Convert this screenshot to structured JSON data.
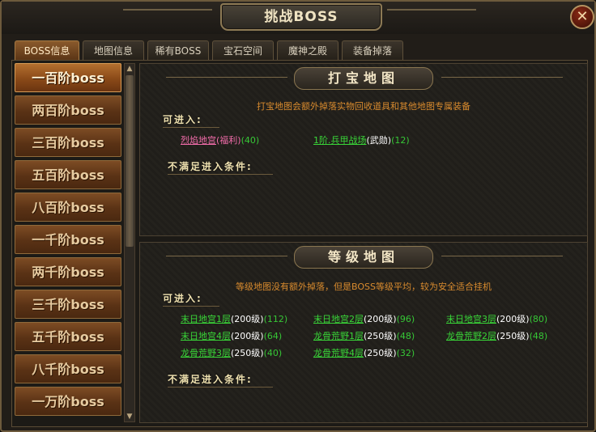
{
  "window": {
    "title": "挑战BOSS",
    "close_label": "✕"
  },
  "tabs": [
    {
      "label": "BOSS信息",
      "active": true
    },
    {
      "label": "地图信息",
      "active": false
    },
    {
      "label": "稀有BOSS",
      "active": false
    },
    {
      "label": "宝石空间",
      "active": false
    },
    {
      "label": "魔神之殿",
      "active": false
    },
    {
      "label": "装备掉落",
      "active": false
    }
  ],
  "boss_list": [
    {
      "label": "一百阶boss",
      "active": true
    },
    {
      "label": "两百阶boss",
      "active": false
    },
    {
      "label": "三百阶boss",
      "active": false
    },
    {
      "label": "五百阶boss",
      "active": false
    },
    {
      "label": "八百阶boss",
      "active": false
    },
    {
      "label": "一千阶boss",
      "active": false
    },
    {
      "label": "两千阶boss",
      "active": false
    },
    {
      "label": "三千阶boss",
      "active": false
    },
    {
      "label": "五千阶boss",
      "active": false
    },
    {
      "label": "八千阶boss",
      "active": false
    },
    {
      "label": "一万阶boss",
      "active": false
    }
  ],
  "treasure_section": {
    "title": "打宝地图",
    "description": "打宝地图会额外掉落实物回收道具和其他地图专属装备",
    "enterable_label": "可进入:",
    "not_met_label": "不满足进入条件:",
    "maps": [
      {
        "name": "烈焰地宫",
        "tag": "(福利)",
        "count": "(40)",
        "color": "pink"
      },
      {
        "name": "1阶.兵甲战场",
        "tag": "(武勋)",
        "count": "(12)",
        "color": "green"
      }
    ]
  },
  "level_section": {
    "title": "等级地图",
    "description": "等级地图没有额外掉落，但是BOSS等级平均，较为安全适合挂机",
    "enterable_label": "可进入:",
    "not_met_label": "不满足进入条件:",
    "maps": [
      {
        "name": "末日地宫1层",
        "level": "(200级)",
        "count": "(112)"
      },
      {
        "name": "末日地宫2层",
        "level": "(200级)",
        "count": "(96)"
      },
      {
        "name": "末日地宫3层",
        "level": "(200级)",
        "count": "(80)"
      },
      {
        "name": "末日地宫4层",
        "level": "(200级)",
        "count": "(64)"
      },
      {
        "name": "龙骨荒野1层",
        "level": "(250级)",
        "count": "(48)"
      },
      {
        "name": "龙骨荒野2层",
        "level": "(250级)",
        "count": "(48)"
      },
      {
        "name": "龙骨荒野3层",
        "level": "(250级)",
        "count": "(40)"
      },
      {
        "name": "龙骨荒野4层",
        "level": "(250级)",
        "count": "(32)"
      }
    ]
  },
  "colors": {
    "link_green": "#39d638",
    "link_pink": "#f06ca9",
    "desc_orange": "#d98b2e",
    "count_green": "#36c736"
  }
}
